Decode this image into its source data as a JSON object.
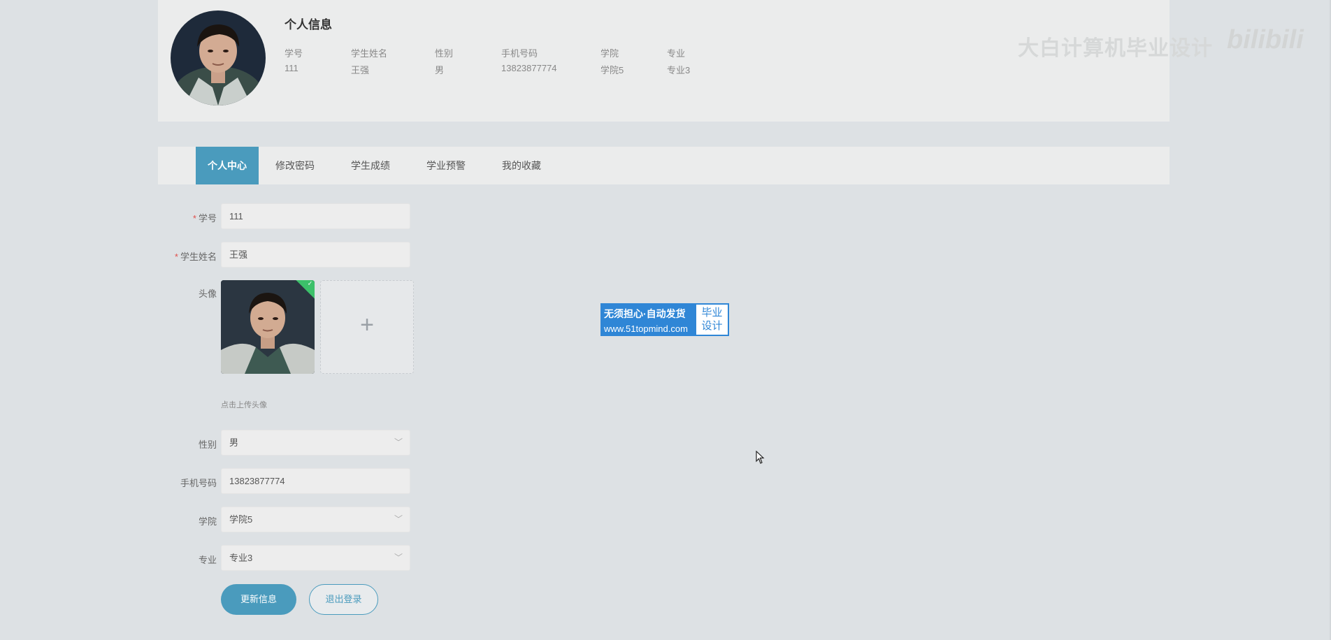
{
  "profile": {
    "title": "个人信息",
    "fields": [
      {
        "label": "学号",
        "value": "111"
      },
      {
        "label": "学生姓名",
        "value": "王强"
      },
      {
        "label": "性别",
        "value": "男"
      },
      {
        "label": "手机号码",
        "value": "13823877774"
      },
      {
        "label": "学院",
        "value": "学院5"
      },
      {
        "label": "专业",
        "value": "专业3"
      }
    ]
  },
  "watermark": {
    "text": "大白计算机毕业设计",
    "logo": "bilibili"
  },
  "tabs": [
    {
      "label": "个人中心",
      "active": true
    },
    {
      "label": "修改密码",
      "active": false
    },
    {
      "label": "学生成绩",
      "active": false
    },
    {
      "label": "学业预警",
      "active": false
    },
    {
      "label": "我的收藏",
      "active": false
    }
  ],
  "form": {
    "student_id": {
      "label": "学号",
      "value": "111",
      "required": true
    },
    "student_name": {
      "label": "学生姓名",
      "value": "王强",
      "required": true
    },
    "avatar": {
      "label": "头像",
      "add_symbol": "+",
      "hint": "点击上传头像"
    },
    "gender": {
      "label": "性别",
      "value": "男"
    },
    "phone": {
      "label": "手机号码",
      "value": "13823877774"
    },
    "college": {
      "label": "学院",
      "value": "学院5"
    },
    "major": {
      "label": "专业",
      "value": "专业3"
    },
    "required_mark": "*"
  },
  "buttons": {
    "update": "更新信息",
    "logout": "退出登录"
  },
  "ad": {
    "line1": "无须担心·自动发货",
    "line2": "www.51topmind.com",
    "right_line1": "毕业",
    "right_line2": "设计"
  },
  "colors": {
    "accent": "#4a9bbd",
    "background": "#dde1e4",
    "card": "#ebecec",
    "required": "#e0504c",
    "success": "#3cc06a",
    "ad_blue": "#2f86d6"
  }
}
